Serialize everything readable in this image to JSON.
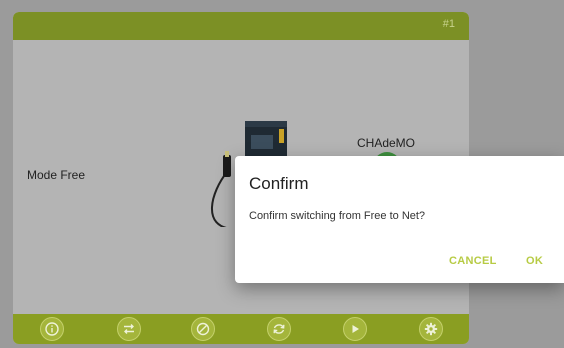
{
  "station": {
    "number": "#1",
    "mode_label": "Mode Free",
    "connector_label": "CHAdeMO",
    "accent_color": "#7c9025",
    "connector_status_color": "#3e8f3e"
  },
  "toolbar": {
    "buttons": [
      {
        "icon": "info-icon"
      },
      {
        "icon": "swap-icon"
      },
      {
        "icon": "block-icon"
      },
      {
        "icon": "refresh-icon"
      },
      {
        "icon": "play-icon"
      },
      {
        "icon": "settings-icon"
      }
    ]
  },
  "dialog": {
    "title": "Confirm",
    "message": "Confirm switching from Free to Net?",
    "cancel_label": "CANCEL",
    "ok_label": "OK",
    "button_color": "#b7cb44"
  }
}
